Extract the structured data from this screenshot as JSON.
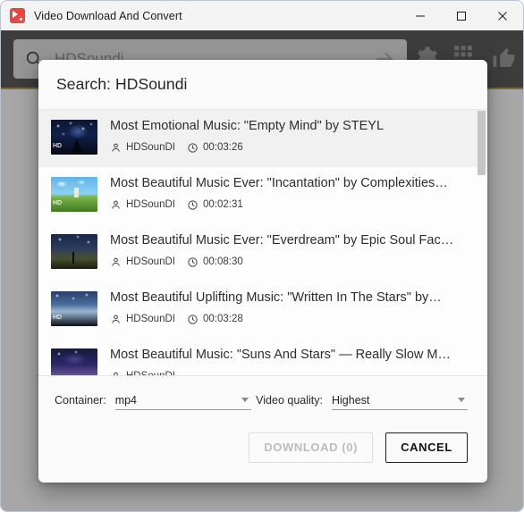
{
  "window": {
    "title": "Video Download And Convert",
    "app_icon": "video-record-icon",
    "controls": {
      "minimize": "minimize-icon",
      "maximize": "maximize-icon",
      "close": "close-icon"
    }
  },
  "app_background": {
    "search": {
      "icon": "search-icon",
      "value": "HDSoundi",
      "submit_icon": "send-arrow-icon"
    },
    "toolbar_icons": [
      "gear-icon",
      "apps-grid-icon",
      "thumbs-up-icon"
    ]
  },
  "dialog": {
    "title": "Search: HDSoundi",
    "results": [
      {
        "title": "Most Emotional Music: \"Empty Mind\" by STEYL",
        "channel": "HDSounDI",
        "duration": "00:03:26",
        "thumb": "starry-night-castle",
        "thumb_class": "th-night",
        "thumb_logo": "HD",
        "hovered": true
      },
      {
        "title": "Most Beautiful Music Ever: \"Incantation\" by Complexities…",
        "channel": "HDSounDI",
        "duration": "00:02:31",
        "thumb": "blue-sky-green-hill",
        "thumb_class": "th-day",
        "thumb_logo": "HD",
        "hovered": false
      },
      {
        "title": "Most Beautiful Music Ever: \"Everdream\" by Epic Soul Fac…",
        "channel": "HDSounDI",
        "duration": "00:08:30",
        "thumb": "night-field-silhouette",
        "thumb_class": "th-field",
        "thumb_logo": "",
        "hovered": false
      },
      {
        "title": "Most Beautiful Uplifting Music: \"Written In The Stars\" by…",
        "channel": "HDSounDI",
        "duration": "00:03:28",
        "thumb": "aurora-mountain-lake",
        "thumb_class": "th-aurora",
        "thumb_logo": "HD",
        "hovered": false
      },
      {
        "title": "Most Beautiful Music: \"Suns And Stars\" — Really Slow M…",
        "channel": "HDSounDI",
        "duration": "",
        "thumb": "purple-galaxy-city",
        "thumb_class": "th-city",
        "thumb_logo": "",
        "hovered": false
      }
    ],
    "channel_icon": "person-icon",
    "duration_icon": "clock-icon",
    "options": {
      "container_label": "Container:",
      "container_value": "mp4",
      "quality_label": "Video quality:",
      "quality_value": "Highest"
    },
    "actions": {
      "download_label": "DOWNLOAD (0)",
      "download_enabled": false,
      "cancel_label": "CANCEL"
    }
  },
  "colors": {
    "accent_red": "#e2483f",
    "dialog_bg": "#fafafa",
    "dark_header": "#1c1c1c",
    "gold_rule": "#7a5d18"
  }
}
